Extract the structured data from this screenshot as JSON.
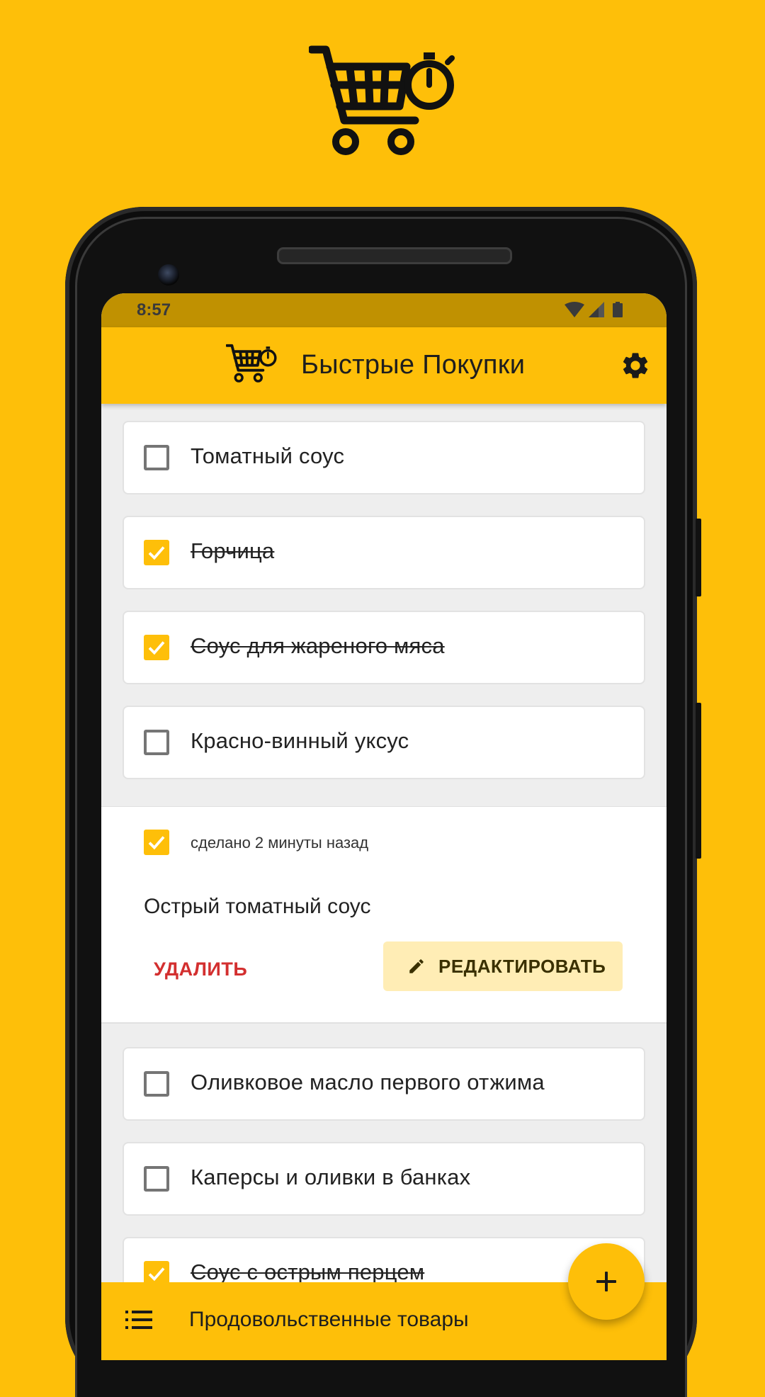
{
  "status_bar": {
    "time": "8:57",
    "icons": [
      "wifi-icon",
      "signal-icon",
      "battery-icon"
    ]
  },
  "app_bar": {
    "title": "Быстрые Покупки",
    "logo": "cart-stopwatch-icon",
    "settings_icon": "gear-icon"
  },
  "items": [
    {
      "label": "Томатный соус",
      "checked": false
    },
    {
      "label": "Горчица",
      "checked": true
    },
    {
      "label": "Соус для жареного мяса",
      "checked": true
    },
    {
      "label": "Красно-винный уксус",
      "checked": false
    }
  ],
  "expanded_item": {
    "checked": true,
    "done_time": "сделано 2 минуты назад",
    "title": "Острый томатный соус",
    "delete_label": "УДАЛИТЬ",
    "edit_label": "РЕДАКТИРОВАТЬ"
  },
  "items_after": [
    {
      "label": "Оливковое масло первого отжима",
      "checked": false
    },
    {
      "label": "Каперсы и оливки в банках",
      "checked": false
    },
    {
      "label": "Соус с острым перцем",
      "checked": true
    }
  ],
  "bottom_bar": {
    "list_name": "Продовольственные товары",
    "menu_icon": "list-icon"
  },
  "fab": {
    "icon": "plus-icon"
  },
  "colors": {
    "accent": "#FEBF09",
    "status_bar": "#C09101",
    "delete": "#D32F2F",
    "edit_bg": "#FFEDB5"
  }
}
